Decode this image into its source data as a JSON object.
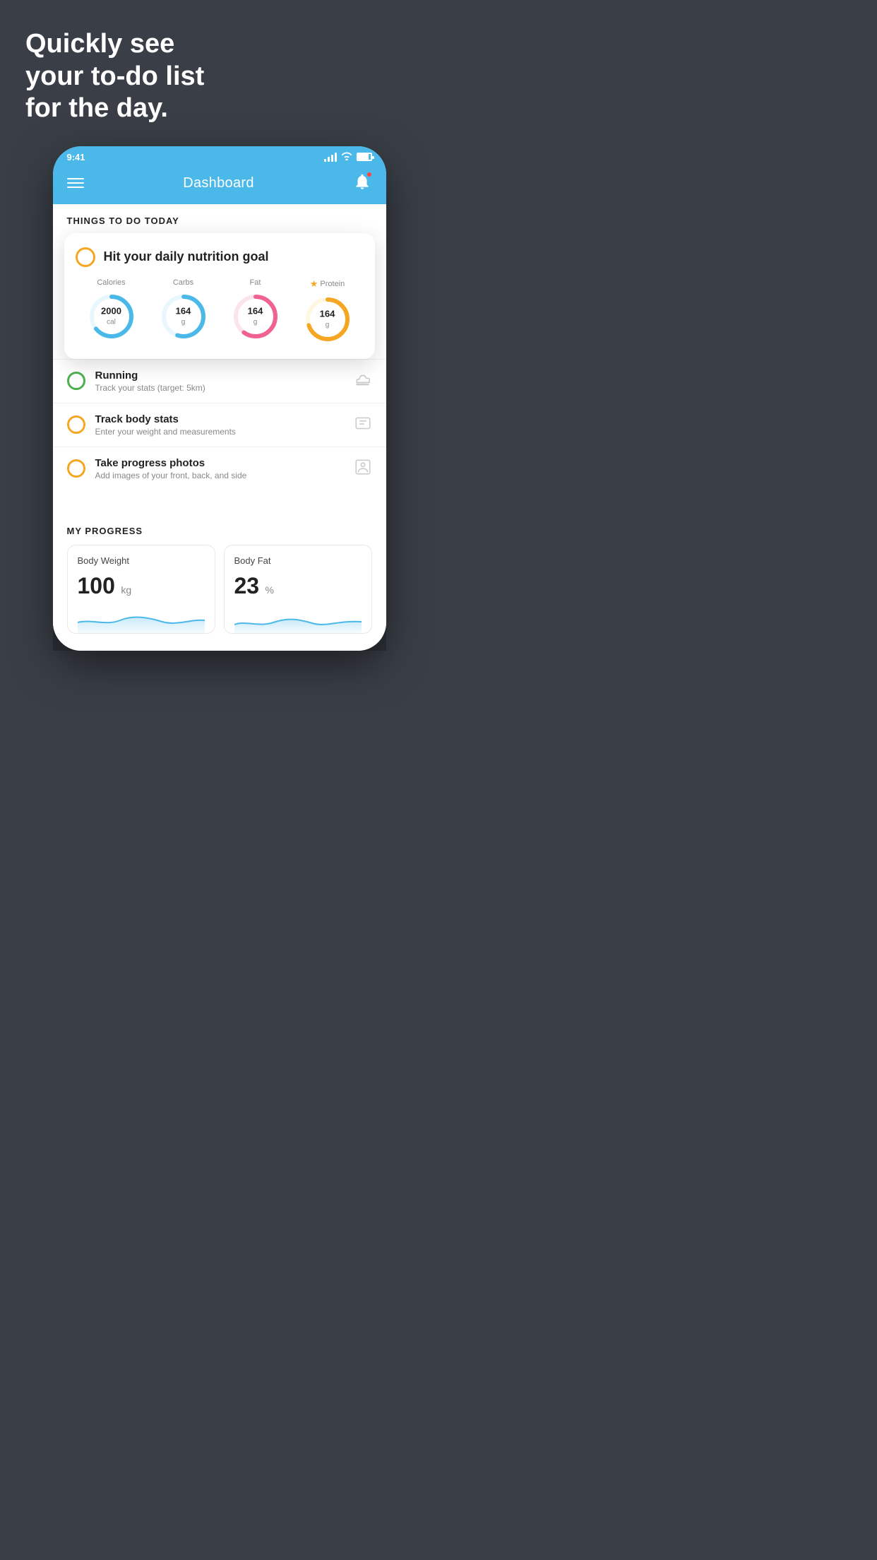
{
  "hero": {
    "line1": "Quickly see",
    "line2": "your to-do list",
    "line3": "for the day."
  },
  "status_bar": {
    "time": "9:41"
  },
  "header": {
    "title": "Dashboard"
  },
  "things_header": "THINGS TO DO TODAY",
  "nutrition_card": {
    "title": "Hit your daily nutrition goal",
    "items": [
      {
        "label": "Calories",
        "value": "2000",
        "unit": "cal",
        "color": "#4ab8e8",
        "bg_color": "#e8f7fd",
        "percent": 65,
        "star": false
      },
      {
        "label": "Carbs",
        "value": "164",
        "unit": "g",
        "color": "#4ab8e8",
        "bg_color": "#e8f7fd",
        "percent": 55,
        "star": false
      },
      {
        "label": "Fat",
        "value": "164",
        "unit": "g",
        "color": "#f06292",
        "bg_color": "#fce4ec",
        "percent": 60,
        "star": false
      },
      {
        "label": "Protein",
        "value": "164",
        "unit": "g",
        "color": "#f5a623",
        "bg_color": "#fff8e1",
        "percent": 70,
        "star": true
      }
    ]
  },
  "todo_items": [
    {
      "title": "Running",
      "subtitle": "Track your stats (target: 5km)",
      "circle_color": "green",
      "icon": "shoe"
    },
    {
      "title": "Track body stats",
      "subtitle": "Enter your weight and measurements",
      "circle_color": "yellow",
      "icon": "scale"
    },
    {
      "title": "Take progress photos",
      "subtitle": "Add images of your front, back, and side",
      "circle_color": "yellow",
      "icon": "person"
    }
  ],
  "progress": {
    "title": "MY PROGRESS",
    "cards": [
      {
        "title": "Body Weight",
        "value": "100",
        "unit": "kg"
      },
      {
        "title": "Body Fat",
        "value": "23",
        "unit": "%"
      }
    ]
  }
}
